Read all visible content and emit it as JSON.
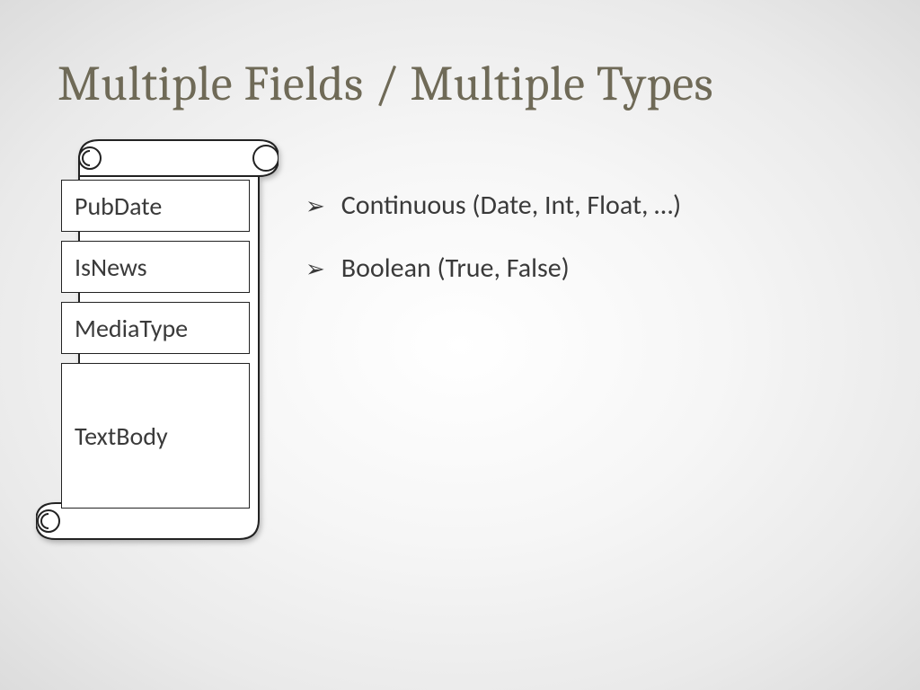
{
  "title": "Multiple Fields / Multiple Types",
  "fields": {
    "f0": "PubDate",
    "f1": "IsNews",
    "f2": "MediaType",
    "f3": "TextBody"
  },
  "bullets": {
    "b0": "Continuous (Date, Int, Float, …)",
    "b1": "Boolean (True, False)"
  }
}
